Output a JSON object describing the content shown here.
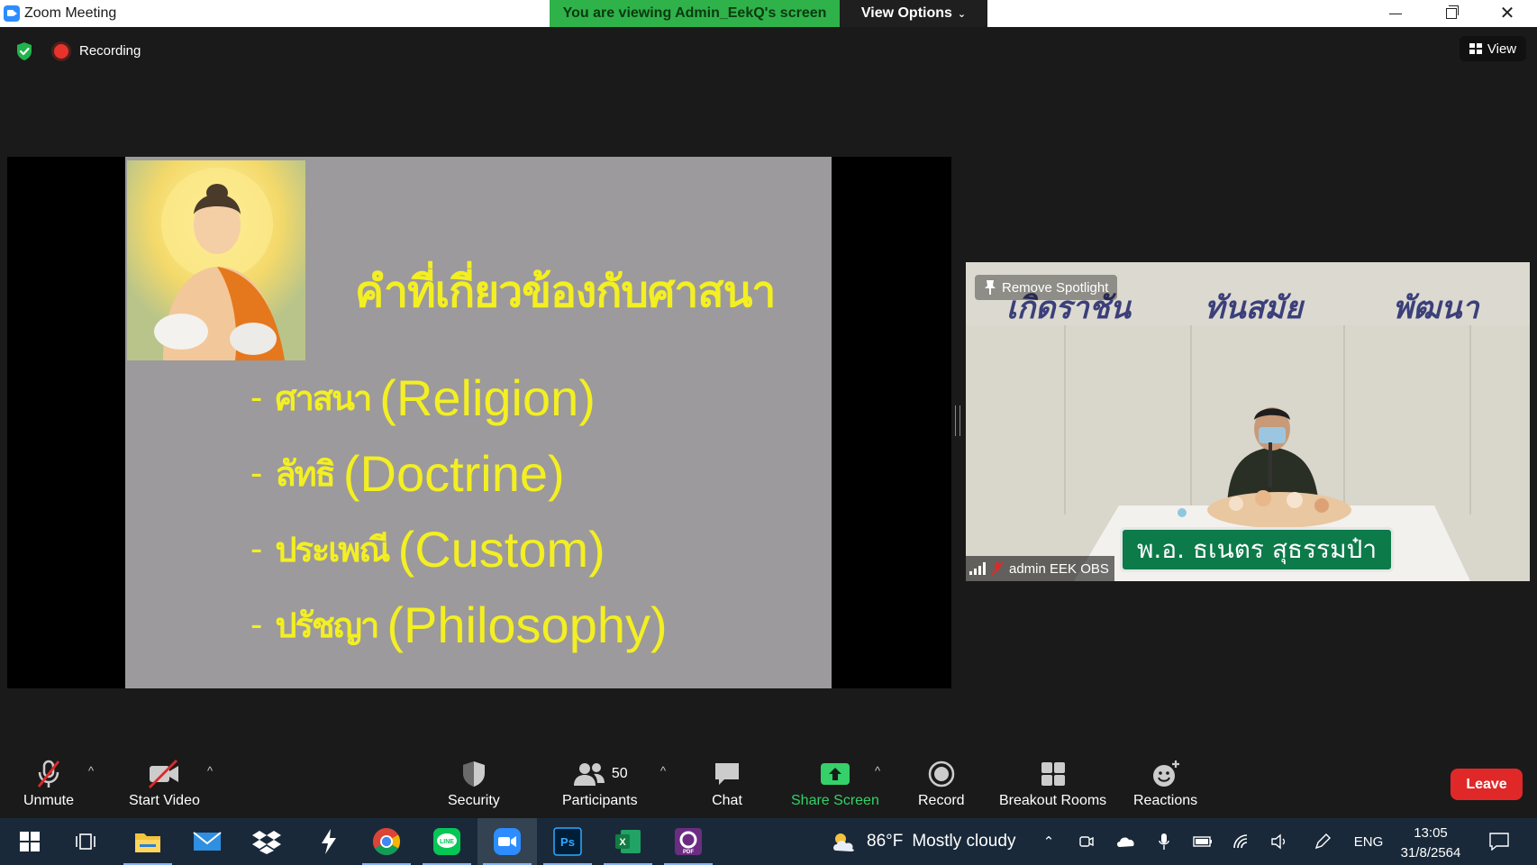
{
  "window": {
    "title": "Zoom Meeting",
    "viewing_banner": "You are viewing Admin_EekQ's screen",
    "view_options_label": "View Options"
  },
  "meeting_bar": {
    "recording_label": "Recording",
    "view_label": "View"
  },
  "slide": {
    "title": "คำที่เกี่ยวข้องกับศาสนา",
    "items": [
      {
        "dash": "-",
        "thai": "ศาสนา",
        "english": "(Religion)"
      },
      {
        "dash": "-",
        "thai": "ลัทธิ",
        "english": "(Doctrine)"
      },
      {
        "dash": "-",
        "thai": "ประเพณี",
        "english": "(Custom)"
      },
      {
        "dash": "-",
        "thai": "ปรัชญา",
        "english": "(Philosophy)"
      }
    ]
  },
  "video_tile": {
    "remove_spotlight_label": "Remove Spotlight",
    "participant_name": "admin EEK OBS",
    "nameplate_text": "พ.อ. ธเนตร สุธรรมป๋า",
    "wall_words": [
      "เกิดราชัน",
      "ทันสมัย",
      "พัฒนา"
    ]
  },
  "toolbar": {
    "unmute": "Unmute",
    "start_video": "Start Video",
    "security": "Security",
    "participants": "Participants",
    "participant_count": "50",
    "chat": "Chat",
    "share_screen": "Share Screen",
    "record": "Record",
    "breakout_rooms": "Breakout Rooms",
    "reactions": "Reactions",
    "leave": "Leave",
    "colors": {
      "share_green": "#35d06a",
      "leave_red": "#e02828",
      "banner_green": "#2fb24a"
    }
  },
  "taskbar": {
    "weather_temp": "86°F",
    "weather_desc": "Mostly cloudy",
    "language": "ENG",
    "time": "13:05",
    "date": "31/8/2564",
    "apps": [
      "windows-start",
      "task-view",
      "file-explorer",
      "mail",
      "dropbox",
      "app-bolt",
      "chrome",
      "line",
      "zoom",
      "photoshop",
      "excel",
      "pdf-app"
    ]
  }
}
